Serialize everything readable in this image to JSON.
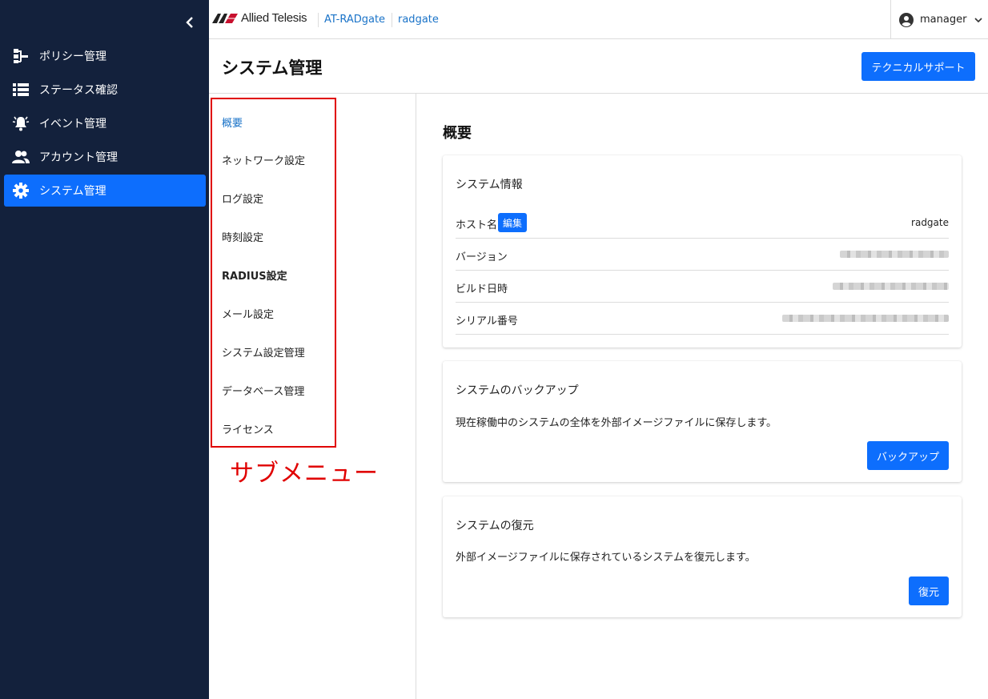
{
  "app": {
    "logo_text": "Allied Telesis",
    "breadcrumb": [
      "AT-RADgate",
      "radgate"
    ],
    "user": "manager"
  },
  "sidebar": {
    "items": [
      {
        "label": "ポリシー管理",
        "icon": "policy-tree-icon",
        "active": false
      },
      {
        "label": "ステータス確認",
        "icon": "list-icon",
        "active": false
      },
      {
        "label": "イベント管理",
        "icon": "bell-icon",
        "active": false
      },
      {
        "label": "アカウント管理",
        "icon": "users-icon",
        "active": false
      },
      {
        "label": "システム管理",
        "icon": "gear-icon",
        "active": true
      }
    ]
  },
  "header": {
    "title": "システム管理",
    "support_label": "テクニカルサポート"
  },
  "submenu": {
    "items": [
      "概要",
      "ネットワーク設定",
      "ログ設定",
      "時刻設定",
      "RADIUS設定",
      "メール設定",
      "システム設定管理",
      "データベース管理",
      "ライセンス"
    ],
    "active_index": 0,
    "annotation": "サブメニュー"
  },
  "main": {
    "section_title": "概要",
    "system_info": {
      "title": "システム情報",
      "edit_label": "編集",
      "rows": [
        {
          "label": "ホスト名",
          "value": "radgate"
        },
        {
          "label": "バージョン",
          "value": ""
        },
        {
          "label": "ビルド日時",
          "value": ""
        },
        {
          "label": "シリアル番号",
          "value": ""
        }
      ]
    },
    "backup": {
      "title": "システムのバックアップ",
      "description": "現在稼働中のシステムの全体を外部イメージファイルに保存します。",
      "button": "バックアップ"
    },
    "restore": {
      "title": "システムの復元",
      "description": "外部イメージファイルに保存されているシステムを復元します。",
      "button": "復元"
    }
  },
  "colors": {
    "sidebar_bg": "#13213c",
    "primary": "#0d6efd",
    "link": "#1a73c8",
    "annotation": "#e00000"
  }
}
